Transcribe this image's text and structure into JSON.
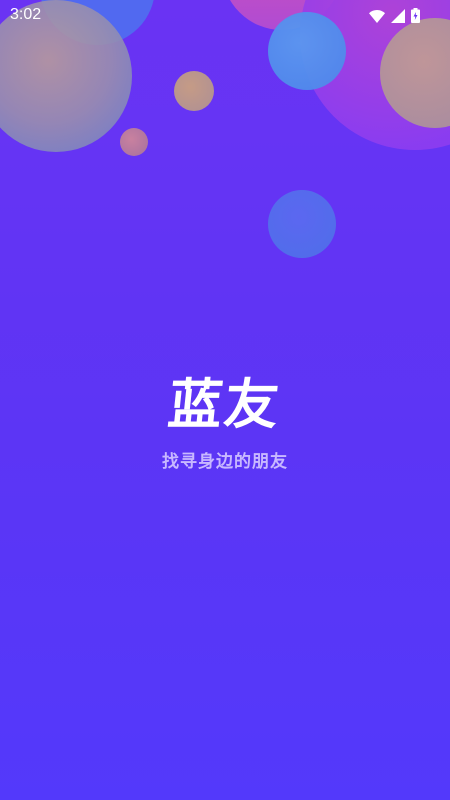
{
  "status_bar": {
    "time": "3:02",
    "icons": [
      "wifi-icon",
      "cell-signal-icon",
      "battery-charging-icon"
    ]
  },
  "app": {
    "title": "蓝友",
    "slogan": "找寻身边的朋友"
  },
  "colors": {
    "background_top": "#6a33f3",
    "background_bottom": "#5339fb",
    "title": "#ffffff",
    "slogan": "#c8b8ff"
  }
}
